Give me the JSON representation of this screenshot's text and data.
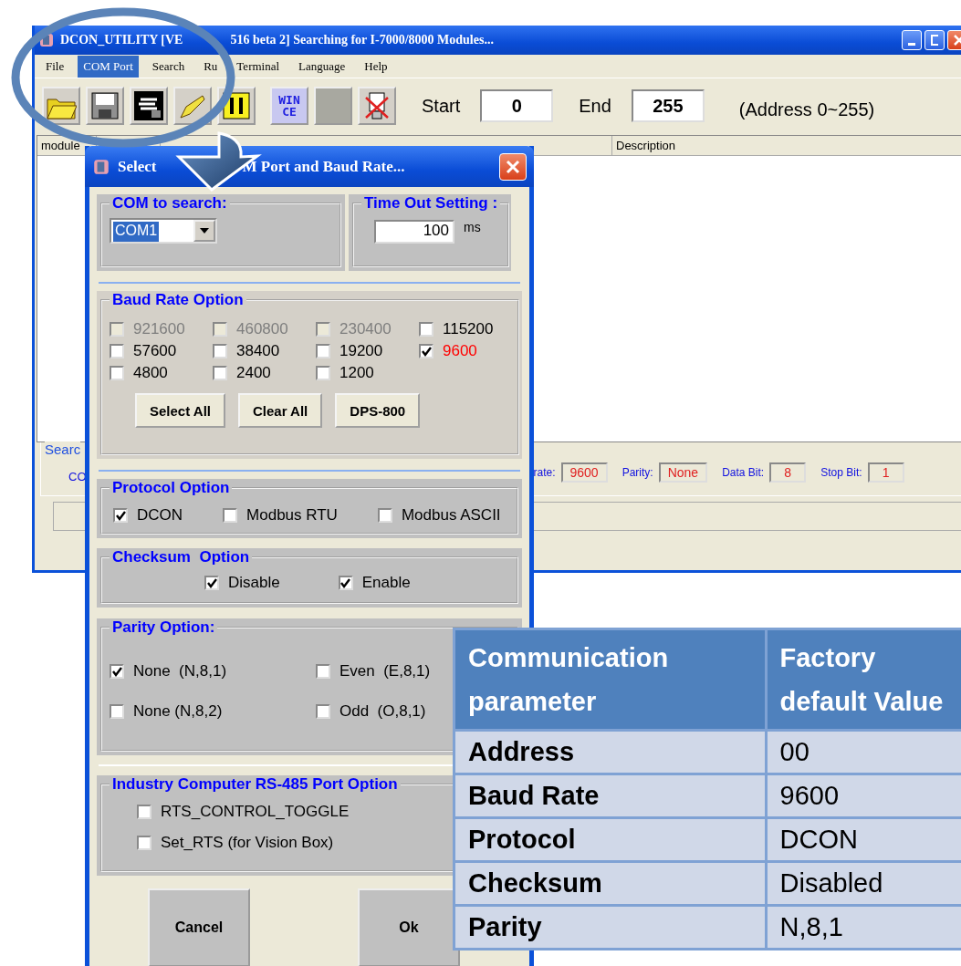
{
  "main_window": {
    "title_parts": [
      "DCON_UTILITY [VE",
      "516 beta 2] Searching for I-7000/8000 Modules..."
    ],
    "menu": [
      {
        "label": "File",
        "selected": false
      },
      {
        "label": "COM Port",
        "selected": true
      },
      {
        "label": "Search",
        "selected": false
      },
      {
        "label": "Ru",
        "selected": false
      },
      {
        "label": "Terminal",
        "selected": false
      },
      {
        "label": "Language",
        "selected": false
      },
      {
        "label": "Help",
        "selected": false
      }
    ],
    "toolbar": {
      "win_ce": [
        "WIN",
        "CE"
      ],
      "start_label": "Start",
      "start_value": "0",
      "end_label": "End",
      "end_value": "255",
      "range_note": "(Address 0~255)"
    },
    "list_columns": [
      "module",
      "Description"
    ],
    "search_group": {
      "legend": "Searc",
      "com_label": "CO",
      "fields": [
        {
          "label": "rate:",
          "value": "9600"
        },
        {
          "label": "Parity:",
          "value": "None"
        },
        {
          "label": "Data Bit:",
          "value": "8"
        },
        {
          "label": "Stop Bit:",
          "value": "1"
        }
      ]
    }
  },
  "dialog": {
    "title_parts": [
      "Select",
      "M Port and Baud Rate..."
    ],
    "com_group": {
      "legend": "COM to search:",
      "value": "COM1"
    },
    "timeout_group": {
      "legend": "Time Out Setting :",
      "value": "100",
      "unit": "ms"
    },
    "baud_group": {
      "legend": "Baud Rate Option",
      "options": [
        {
          "label": "921600",
          "checked": false,
          "disabled": true
        },
        {
          "label": "460800",
          "checked": false,
          "disabled": true
        },
        {
          "label": "230400",
          "checked": false,
          "disabled": true
        },
        {
          "label": "115200",
          "checked": false,
          "disabled": false
        },
        {
          "label": "57600",
          "checked": false,
          "disabled": false
        },
        {
          "label": "38400",
          "checked": false,
          "disabled": false
        },
        {
          "label": "19200",
          "checked": false,
          "disabled": false
        },
        {
          "label": "9600",
          "checked": true,
          "disabled": false
        },
        {
          "label": "4800",
          "checked": false,
          "disabled": false
        },
        {
          "label": "2400",
          "checked": false,
          "disabled": false
        },
        {
          "label": "1200",
          "checked": false,
          "disabled": false
        }
      ],
      "buttons": [
        "Select All",
        "Clear All",
        "DPS-800"
      ]
    },
    "protocol_group": {
      "legend": "Protocol Option",
      "options": [
        {
          "label": "DCON",
          "checked": true
        },
        {
          "label": "Modbus RTU",
          "checked": false
        },
        {
          "label": "Modbus ASCII",
          "checked": false
        }
      ]
    },
    "checksum_group": {
      "legend": "Checksum  Option",
      "options": [
        {
          "label": "Disable",
          "checked": true
        },
        {
          "label": "Enable",
          "checked": true
        }
      ]
    },
    "parity_group": {
      "legend": "Parity Option:",
      "options": [
        {
          "label": "None  (N,8,1)",
          "checked": true
        },
        {
          "label": "Even  (E,8,1)",
          "checked": false
        },
        {
          "label": "None (N,8,2)",
          "checked": false
        },
        {
          "label": "Odd  (O,8,1)",
          "checked": false
        }
      ]
    },
    "rs485_group": {
      "legend": "Industry Computer RS-485 Port Option",
      "options": [
        {
          "label": "RTS_CONTROL_TOGGLE",
          "checked": false
        },
        {
          "label": "Set_RTS (for Vision Box)",
          "checked": false
        }
      ]
    },
    "buttons": [
      "Cancel",
      "Ok"
    ]
  },
  "defaults_table": {
    "columns": [
      "Communication parameter",
      "Factory default Value"
    ],
    "rows": [
      [
        "Address",
        "00"
      ],
      [
        "Baud Rate",
        "9600"
      ],
      [
        "Protocol",
        "DCON"
      ],
      [
        "Checksum",
        "Disabled"
      ],
      [
        "Parity",
        "N,8,1"
      ]
    ]
  }
}
